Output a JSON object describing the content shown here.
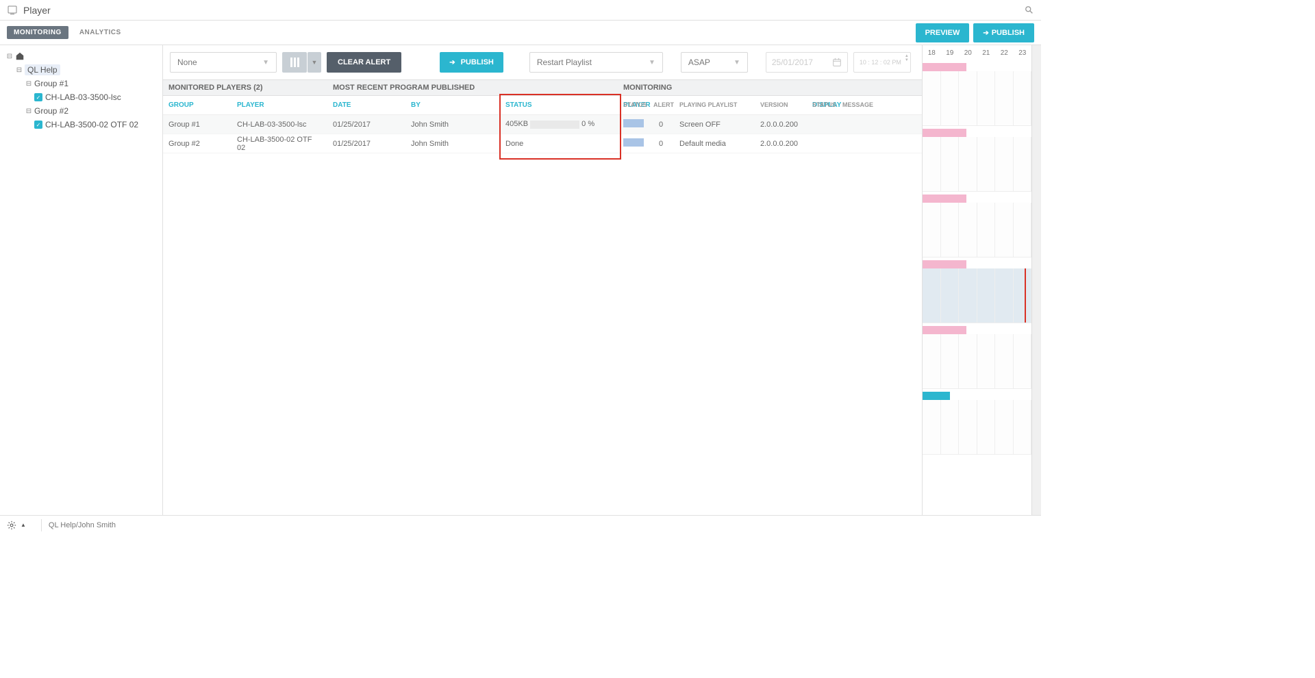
{
  "header": {
    "title": "Player"
  },
  "tabs": {
    "monitoring": "MONITORING",
    "analytics": "ANALYTICS"
  },
  "buttons": {
    "preview": "PREVIEW",
    "publish": "PUBLISH",
    "clear_alert": "CLEAR ALERT",
    "publish_small": "PUBLISH"
  },
  "toolbar": {
    "filter": "None",
    "restart": "Restart Playlist",
    "when": "ASAP",
    "date_placeholder": "25/01/2017",
    "time_placeholder": "10 : 12 : 02 PM"
  },
  "tree": {
    "root": "QL Help",
    "groups": [
      {
        "label": "Group #1",
        "players": [
          "CH-LAB-03-3500-lsc"
        ]
      },
      {
        "label": "Group #2",
        "players": [
          "CH-LAB-3500-02 OTF 02"
        ]
      }
    ]
  },
  "sections": {
    "monitored": "MONITORED PLAYERS (2)",
    "recent": "MOST RECENT PROGRAM PUBLISHED",
    "monitoring": "MONITORING"
  },
  "columns": {
    "group": "GROUP",
    "player": "PLAYER",
    "date": "DATE",
    "by": "BY",
    "status": "STATUS",
    "player2": "PLAYER",
    "mstatus": "STATUS",
    "alert": "ALERT",
    "playlist": "PLAYING PLAYLIST",
    "version": "VERSION",
    "display": "DISPLAY",
    "dstatus": "STATUS",
    "message": "MESSAGE"
  },
  "rows": [
    {
      "group": "Group #1",
      "player": "CH-LAB-03-3500-lsc",
      "date": "01/25/2017",
      "by": "John Smith",
      "status_size": "405KB",
      "status_pct": "0 %",
      "alert": "0",
      "playlist": "Screen OFF",
      "version": "2.0.0.0.200"
    },
    {
      "group": "Group #2",
      "player": "CH-LAB-3500-02 OTF 02",
      "date": "01/25/2017",
      "by": "John Smith",
      "status_text": "Done",
      "alert": "0",
      "playlist": "Default media",
      "version": "2.0.0.0.200"
    }
  ],
  "timeline": {
    "hours": [
      "18",
      "19",
      "20",
      "21",
      "22",
      "23"
    ]
  },
  "footer": {
    "path": "QL Help/John Smith"
  }
}
